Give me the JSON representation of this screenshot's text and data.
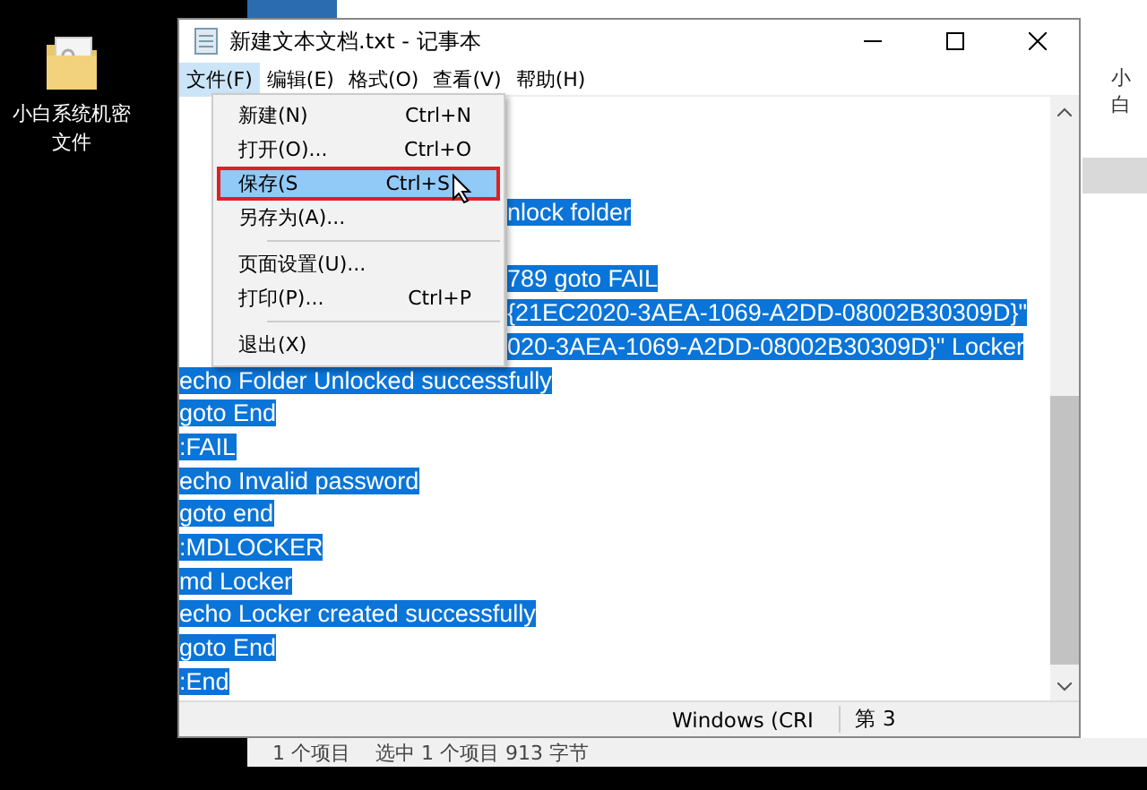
{
  "desktop_icon": {
    "label": "小白系统机密文件"
  },
  "explorer": {
    "address_fragment": "小白",
    "status_bar": [
      "1 个项目",
      "选中 1 个项目  913 字节"
    ]
  },
  "window": {
    "title": "新建文本文档.txt - 记事本"
  },
  "menubar": [
    {
      "label": "文件(F)",
      "selected": true
    },
    {
      "label": "编辑(E)",
      "selected": false
    },
    {
      "label": "格式(O)",
      "selected": false
    },
    {
      "label": "查看(V)",
      "selected": false
    },
    {
      "label": "帮助(H)",
      "selected": false
    }
  ],
  "file_menu": [
    {
      "kind": "item",
      "label": "新建(N)",
      "shortcut": "Ctrl+N",
      "selected": false
    },
    {
      "kind": "item",
      "label": "打开(O)...",
      "shortcut": "Ctrl+O",
      "selected": false
    },
    {
      "kind": "item",
      "label": "保存(S",
      "shortcut": "Ctrl+S",
      "selected": true
    },
    {
      "kind": "item",
      "label": "另存为(A)...",
      "selected": false
    },
    {
      "kind": "separator"
    },
    {
      "kind": "item",
      "label": "页面设置(U)...",
      "selected": false
    },
    {
      "kind": "item",
      "label": "打印(P)...",
      "shortcut": "Ctrl+P",
      "selected": false
    },
    {
      "kind": "separator"
    },
    {
      "kind": "item",
      "label": "退出(X)",
      "selected": false
    }
  ],
  "editor_lines": [
    {
      "kind": "covered"
    },
    {
      "kind": "covered"
    },
    {
      "kind": "covered"
    },
    {
      "kind": "partial",
      "text": "nlock folder"
    },
    {
      "kind": "covered"
    },
    {
      "kind": "partial",
      "text": "789 goto FAIL"
    },
    {
      "kind": "partial",
      "text": "{21EC2020-3AEA-1069-A2DD-08002B30309D}\""
    },
    {
      "kind": "partial",
      "text": "020-3AEA-1069-A2DD-08002B30309D}\" Locker"
    },
    {
      "kind": "full",
      "text": "echo Folder Unlocked successfully"
    },
    {
      "kind": "full",
      "text": "goto End"
    },
    {
      "kind": "full",
      "text": ":FAIL"
    },
    {
      "kind": "full",
      "text": "echo Invalid password"
    },
    {
      "kind": "full",
      "text": "goto end"
    },
    {
      "kind": "full",
      "text": ":MDLOCKER"
    },
    {
      "kind": "full",
      "text": "md Locker"
    },
    {
      "kind": "full",
      "text": "echo Locker created successfully"
    },
    {
      "kind": "full",
      "text": "goto End"
    },
    {
      "kind": "full",
      "text": ":End"
    }
  ],
  "status_bar": [
    "Windows (CRI",
    "第 3"
  ]
}
